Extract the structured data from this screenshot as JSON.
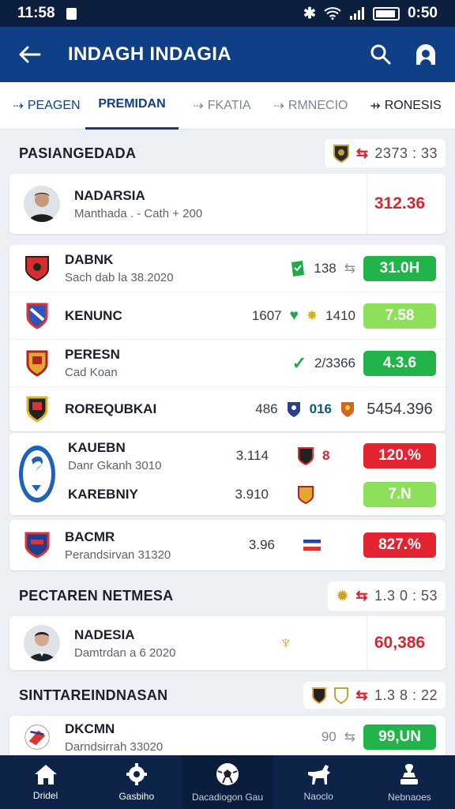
{
  "status": {
    "time": "11:58",
    "battery_time": "0:50"
  },
  "appbar": {
    "title": "INDAGH INDAGIA"
  },
  "tabs": [
    "PEAGEN",
    "PREMIDAN",
    "FKATIA",
    "RMNECIO",
    "RONESIS"
  ],
  "section1": {
    "title": "PASIANGEDADA",
    "value": "2373 : 33"
  },
  "featured": {
    "name": "NADARSIA",
    "sub": "Manthada . - Cath + 200",
    "value": "312.36"
  },
  "rows": [
    {
      "name": "DABNK",
      "sub": "Sach dab la 38.2020",
      "mid": "138",
      "value": "31.0H"
    },
    {
      "name": "KENUNC",
      "mid1": "1607",
      "mid2": "1410",
      "value": "7.58"
    },
    {
      "name": "PERESN",
      "sub": "Cad Koan",
      "mid": "2/3366",
      "value": "4.3.6"
    },
    {
      "name": "ROREQUBKAI",
      "mid1": "486",
      "mid2": "016",
      "value": "5454.396"
    }
  ],
  "combined": {
    "name1": "KAUEBN",
    "sub1": "Danr Gkanh 3010",
    "mid1": "3.114",
    "val1": "120.%",
    "icon_text": "8",
    "name2": "KAREBNIY",
    "mid2": "3.910",
    "val2": "7.N"
  },
  "bacmr": {
    "name": "BACMR",
    "sub": "Perandsirvan 31320",
    "mid": "3.96",
    "value": "827.%"
  },
  "section2": {
    "title": "PECTAREN NETMESA",
    "value": "1.3 0 : 53"
  },
  "nadesia": {
    "name": "NADESIA",
    "sub": "Damtrdan a 6 2020",
    "value": "60,386"
  },
  "section3": {
    "title": "SINTTAREINDNASAN",
    "value": "1.3 8 : 22"
  },
  "dkcmn": {
    "name": "DKCMN",
    "sub": "Darndsirrah 33020",
    "mid": "90",
    "value": "99,UN"
  },
  "bottom_nav": [
    "Dridel",
    "Gasbiho",
    "Dacadiogon Gau",
    "Naoclo",
    "Nebnaoes"
  ],
  "colors": {
    "header": "#0f3f86",
    "green": "#22b34b",
    "light_green": "#8ee05a",
    "red": "#e3232f",
    "nav": "#0d2448"
  }
}
